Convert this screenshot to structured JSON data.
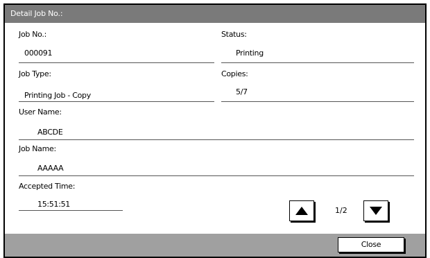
{
  "dialog": {
    "title": "Detail Job No.:"
  },
  "fields": {
    "job_no": {
      "label": "Job No.:",
      "value": "000091"
    },
    "status": {
      "label": "Status:",
      "value": "Printing"
    },
    "job_type": {
      "label": "Job Type:",
      "value": "Printing Job - Copy"
    },
    "copies": {
      "label": "Copies:",
      "value": "5/7"
    },
    "user_name": {
      "label": "User Name:",
      "value": "ABCDE"
    },
    "job_name": {
      "label": "Job Name:",
      "value": "AAAAA"
    },
    "accepted_time": {
      "label": "Accepted Time:",
      "value": "15:51:51"
    }
  },
  "pager": {
    "indicator": "1/2",
    "up_icon": "triangle-up",
    "down_icon": "triangle-down"
  },
  "footer": {
    "close_label": "Close"
  },
  "colors": {
    "titlebar": "#7a7a7a",
    "footer": "#a0a0a0"
  }
}
